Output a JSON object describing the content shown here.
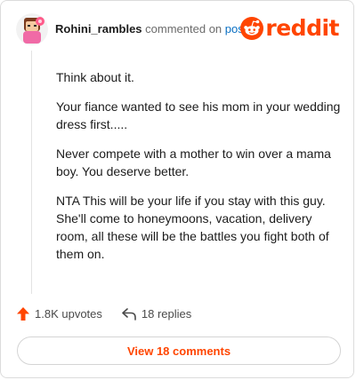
{
  "comment": {
    "username": "Rohini_rambles",
    "commented_on_text": "commented on",
    "post_link_text": "post",
    "paragraphs": [
      "Think about it.",
      "Your fiance wanted to see his mom in your wedding dress first.....",
      "Never compete with a mother to win over a mama boy. You deserve better.",
      "NTA This will be your life if you stay with this guy. She'll come to honeymoons, vacation, delivery room, all these will be the battles you fight both of them on."
    ]
  },
  "brand": {
    "wordmark": "reddit",
    "color": "#ff4500"
  },
  "actions": {
    "upvotes_label": "1.8K upvotes",
    "replies_label": "18 replies"
  },
  "footer": {
    "view_comments_label": "View 18 comments"
  },
  "icons": {
    "upvote": "upvote-arrow-icon",
    "reply": "reply-arrow-icon",
    "logo": "reddit-snoo-icon",
    "avatar": "user-avatar-icon"
  }
}
